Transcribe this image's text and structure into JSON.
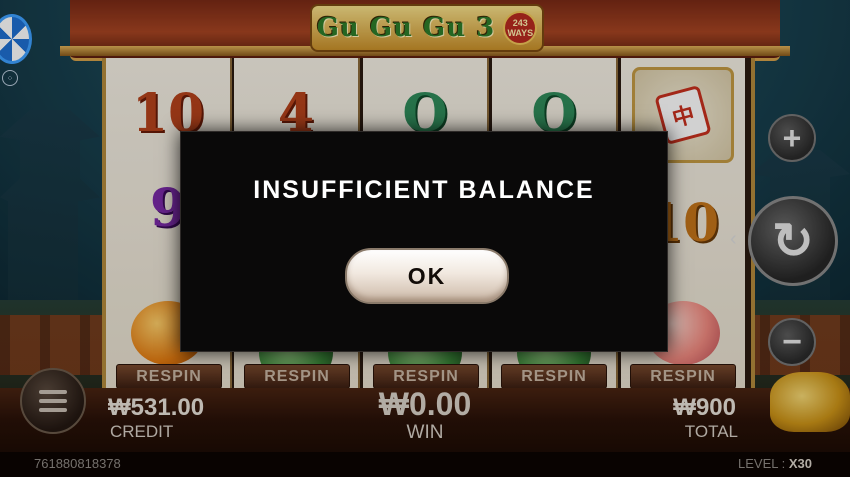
{
  "game": {
    "logo_text": "Gu Gu Gu 3",
    "ways_number": "243",
    "ways_label": "WAYS"
  },
  "reels": [
    {
      "top": "10",
      "mid": "9",
      "bottom": "orange"
    },
    {
      "top": "4",
      "mid": "",
      "bottom": "leafy"
    },
    {
      "top": "Q",
      "mid": "",
      "bottom": "leafy"
    },
    {
      "top": "Q",
      "mid": "",
      "bottom": "leafy"
    },
    {
      "top": "tile",
      "mid": "10",
      "bottom": "peach"
    }
  ],
  "mahjong_char": "中",
  "respin_labels": [
    "RESPIN",
    "RESPIN",
    "RESPIN",
    "RESPIN",
    "RESPIN"
  ],
  "credit": {
    "value": "₩531.00",
    "label": "CREDIT"
  },
  "win": {
    "value": "₩0.00",
    "label": "WIN"
  },
  "total": {
    "value": "₩900",
    "label": "TOTAL"
  },
  "session_id": "761880818378",
  "level": {
    "label": "LEVEL :",
    "value": "X30"
  },
  "controls": {
    "plus": "+",
    "minus": "−",
    "spin": "↻",
    "spin_hint": "‹"
  },
  "dialog": {
    "message": "INSUFFICIENT BALANCE",
    "ok_label": "OK"
  },
  "colors": {
    "modal_bg": "#0a0909",
    "frame_wood": "#a64422",
    "gold_trim": "#d6a24a"
  },
  "icons": [
    "lucky-wheel-icon",
    "grid-dots-icon",
    "menu-icon",
    "plus-icon",
    "minus-icon",
    "spin-icon",
    "gold-ingots-icon"
  ]
}
